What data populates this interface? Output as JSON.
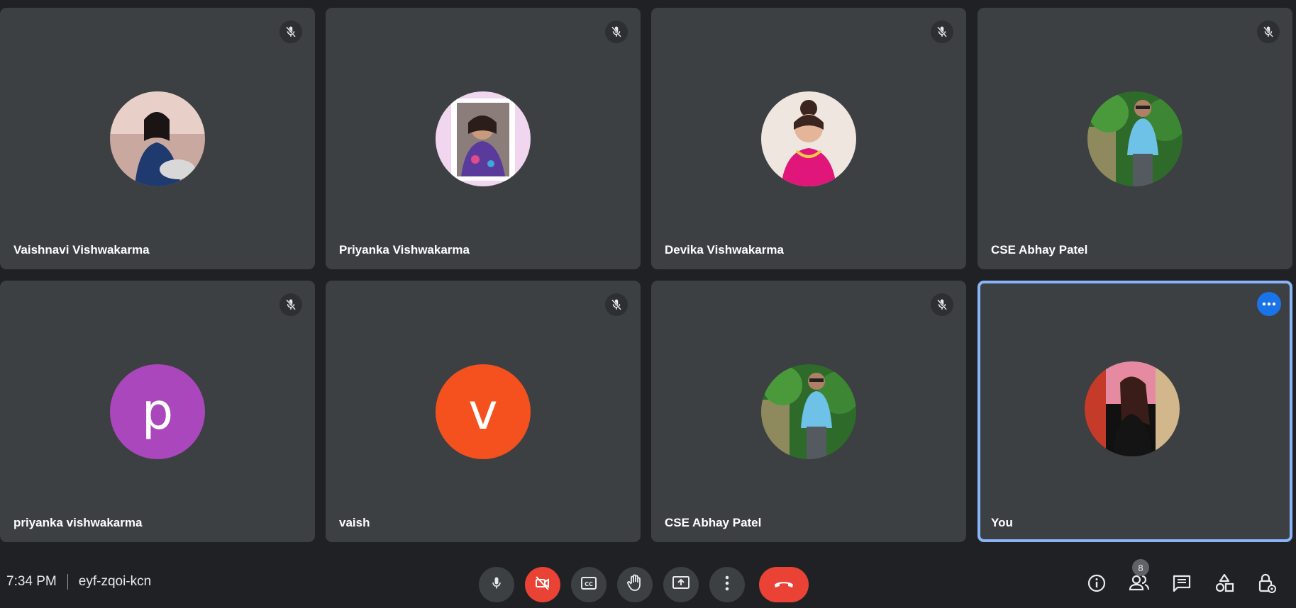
{
  "participants": [
    {
      "name": "Vaishnavi Vishwakarma",
      "muted": true
    },
    {
      "name": "Priyanka Vishwakarma",
      "muted": true
    },
    {
      "name": "Devika Vishwakarma",
      "muted": true
    },
    {
      "name": "CSE Abhay Patel",
      "muted": true
    },
    {
      "name": "priyanka vishwakarma",
      "muted": true,
      "initial": "p",
      "color": "#ab47bc"
    },
    {
      "name": "vaish",
      "muted": true,
      "initial": "v",
      "color": "#f4511e"
    },
    {
      "name": "CSE Abhay Patel",
      "muted": true
    },
    {
      "name": "You",
      "muted": false
    }
  ],
  "meeting": {
    "time": "7:34 PM",
    "code": "eyf-zqoi-kcn"
  },
  "controls": {
    "icons": [
      "mic-icon",
      "camera-off-icon",
      "captions-icon",
      "raise-hand-icon",
      "present-icon",
      "more-options-icon",
      "hang-up-icon"
    ]
  },
  "side_panel": {
    "people_count": "8",
    "icons": [
      "info-icon",
      "people-icon",
      "chat-icon",
      "activities-icon",
      "host-controls-icon"
    ]
  },
  "colors": {
    "background": "#202124",
    "tile": "#3c4043",
    "active_border": "#8ab4f8",
    "hangup": "#ea4335"
  }
}
